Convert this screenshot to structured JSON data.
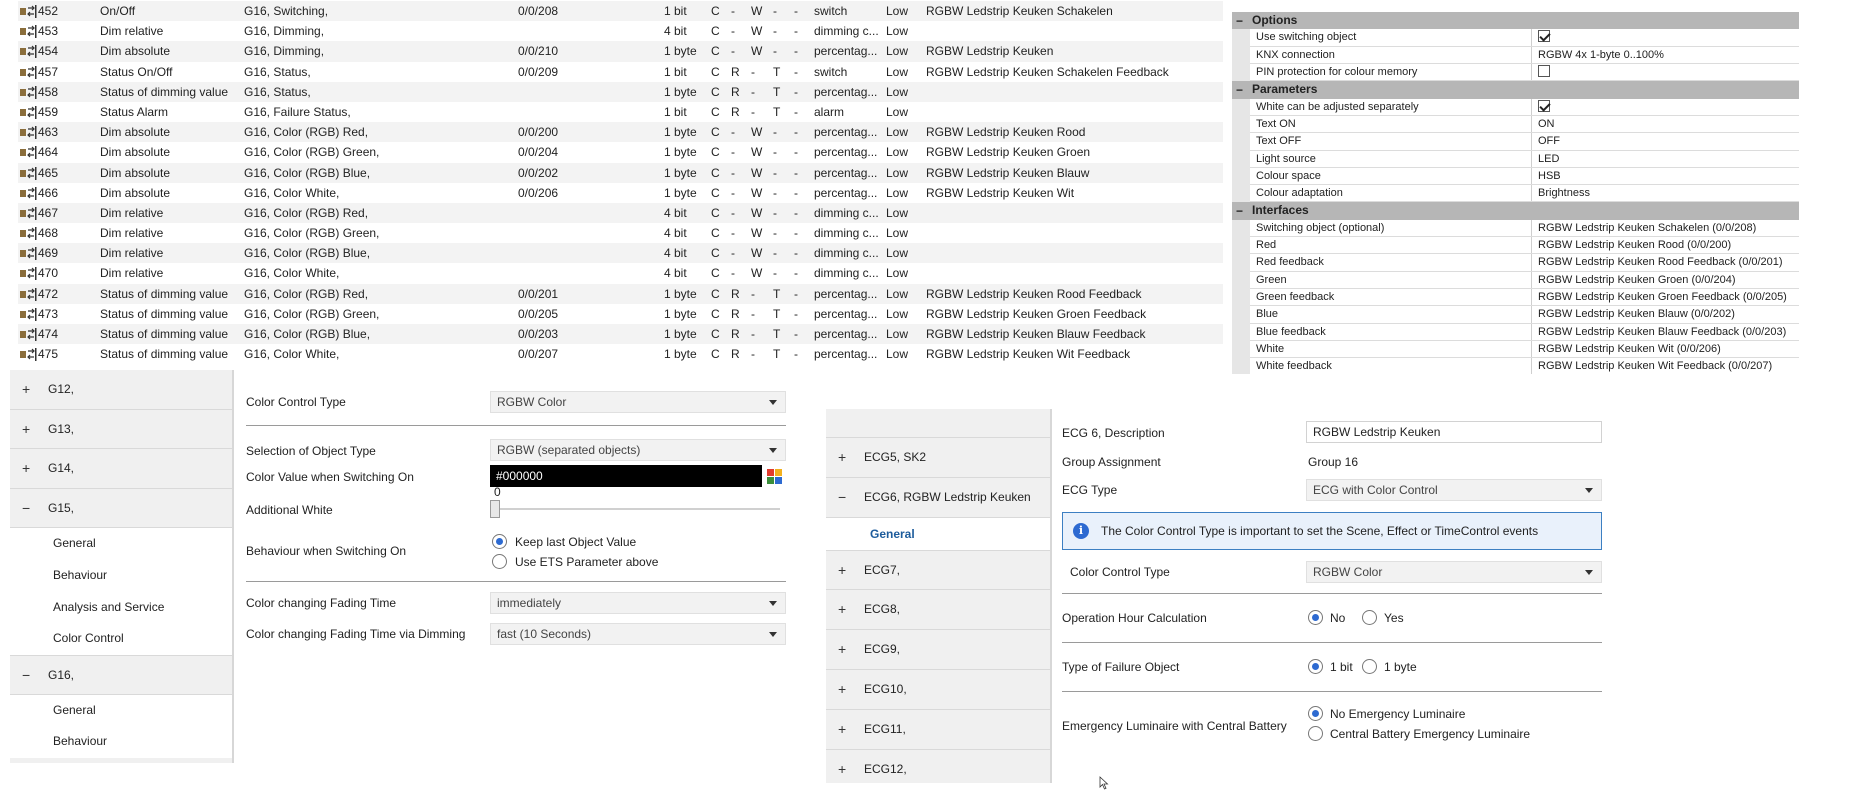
{
  "objects": [
    {
      "num": "452",
      "name": "On/Off",
      "func": "G16, Switching,",
      "addr": "0/0/208",
      "len": "1 bit",
      "c": "C",
      "r": "-",
      "w": "W",
      "t": "-",
      "u": "-",
      "dpt": "switch",
      "prio": "Low",
      "desc": "RGBW Ledstrip Keuken Schakelen"
    },
    {
      "num": "453",
      "name": "Dim relative",
      "func": "G16, Dimming,",
      "addr": "",
      "len": "4 bit",
      "c": "C",
      "r": "-",
      "w": "W",
      "t": "-",
      "u": "-",
      "dpt": "dimming c...",
      "prio": "Low",
      "desc": ""
    },
    {
      "num": "454",
      "name": "Dim absolute",
      "func": "G16, Dimming,",
      "addr": "0/0/210",
      "len": "1 byte",
      "c": "C",
      "r": "-",
      "w": "W",
      "t": "-",
      "u": "-",
      "dpt": "percentag...",
      "prio": "Low",
      "desc": "RGBW Ledstrip Keuken"
    },
    {
      "num": "457",
      "name": "Status On/Off",
      "func": "G16, Status,",
      "addr": "0/0/209",
      "len": "1 bit",
      "c": "C",
      "r": "R",
      "w": "-",
      "t": "T",
      "u": "-",
      "dpt": "switch",
      "prio": "Low",
      "desc": "RGBW Ledstrip Keuken Schakelen Feedback"
    },
    {
      "num": "458",
      "name": "Status of dimming value",
      "func": "G16, Status,",
      "addr": "",
      "len": "1 byte",
      "c": "C",
      "r": "R",
      "w": "-",
      "t": "T",
      "u": "-",
      "dpt": "percentag...",
      "prio": "Low",
      "desc": ""
    },
    {
      "num": "459",
      "name": "Status Alarm",
      "func": "G16, Failure Status,",
      "addr": "",
      "len": "1 bit",
      "c": "C",
      "r": "R",
      "w": "-",
      "t": "T",
      "u": "-",
      "dpt": "alarm",
      "prio": "Low",
      "desc": ""
    },
    {
      "num": "463",
      "name": "Dim absolute",
      "func": "G16, Color (RGB) Red,",
      "addr": "0/0/200",
      "len": "1 byte",
      "c": "C",
      "r": "-",
      "w": "W",
      "t": "-",
      "u": "-",
      "dpt": "percentag...",
      "prio": "Low",
      "desc": "RGBW Ledstrip Keuken Rood"
    },
    {
      "num": "464",
      "name": "Dim absolute",
      "func": "G16, Color (RGB) Green,",
      "addr": "0/0/204",
      "len": "1 byte",
      "c": "C",
      "r": "-",
      "w": "W",
      "t": "-",
      "u": "-",
      "dpt": "percentag...",
      "prio": "Low",
      "desc": "RGBW Ledstrip Keuken Groen"
    },
    {
      "num": "465",
      "name": "Dim absolute",
      "func": "G16, Color (RGB) Blue,",
      "addr": "0/0/202",
      "len": "1 byte",
      "c": "C",
      "r": "-",
      "w": "W",
      "t": "-",
      "u": "-",
      "dpt": "percentag...",
      "prio": "Low",
      "desc": "RGBW Ledstrip Keuken Blauw"
    },
    {
      "num": "466",
      "name": "Dim absolute",
      "func": "G16, Color White,",
      "addr": "0/0/206",
      "len": "1 byte",
      "c": "C",
      "r": "-",
      "w": "W",
      "t": "-",
      "u": "-",
      "dpt": "percentag...",
      "prio": "Low",
      "desc": "RGBW Ledstrip Keuken Wit"
    },
    {
      "num": "467",
      "name": "Dim relative",
      "func": "G16, Color (RGB) Red,",
      "addr": "",
      "len": "4 bit",
      "c": "C",
      "r": "-",
      "w": "W",
      "t": "-",
      "u": "-",
      "dpt": "dimming c...",
      "prio": "Low",
      "desc": ""
    },
    {
      "num": "468",
      "name": "Dim relative",
      "func": "G16, Color (RGB) Green,",
      "addr": "",
      "len": "4 bit",
      "c": "C",
      "r": "-",
      "w": "W",
      "t": "-",
      "u": "-",
      "dpt": "dimming c...",
      "prio": "Low",
      "desc": ""
    },
    {
      "num": "469",
      "name": "Dim relative",
      "func": "G16, Color (RGB) Blue,",
      "addr": "",
      "len": "4 bit",
      "c": "C",
      "r": "-",
      "w": "W",
      "t": "-",
      "u": "-",
      "dpt": "dimming c...",
      "prio": "Low",
      "desc": ""
    },
    {
      "num": "470",
      "name": "Dim relative",
      "func": "G16, Color White,",
      "addr": "",
      "len": "4 bit",
      "c": "C",
      "r": "-",
      "w": "W",
      "t": "-",
      "u": "-",
      "dpt": "dimming c...",
      "prio": "Low",
      "desc": ""
    },
    {
      "num": "472",
      "name": "Status of dimming value",
      "func": "G16, Color (RGB) Red,",
      "addr": "0/0/201",
      "len": "1 byte",
      "c": "C",
      "r": "R",
      "w": "-",
      "t": "T",
      "u": "-",
      "dpt": "percentag...",
      "prio": "Low",
      "desc": "RGBW Ledstrip Keuken Rood Feedback"
    },
    {
      "num": "473",
      "name": "Status of dimming value",
      "func": "G16, Color (RGB) Green,",
      "addr": "0/0/205",
      "len": "1 byte",
      "c": "C",
      "r": "R",
      "w": "-",
      "t": "T",
      "u": "-",
      "dpt": "percentag...",
      "prio": "Low",
      "desc": "RGBW Ledstrip Keuken Groen Feedback"
    },
    {
      "num": "474",
      "name": "Status of dimming value",
      "func": "G16, Color (RGB) Blue,",
      "addr": "0/0/203",
      "len": "1 byte",
      "c": "C",
      "r": "R",
      "w": "-",
      "t": "T",
      "u": "-",
      "dpt": "percentag...",
      "prio": "Low",
      "desc": "RGBW Ledstrip Keuken Blauw Feedback"
    },
    {
      "num": "475",
      "name": "Status of dimming value",
      "func": "G16, Color White,",
      "addr": "0/0/207",
      "len": "1 byte",
      "c": "C",
      "r": "R",
      "w": "-",
      "t": "T",
      "u": "-",
      "dpt": "percentag...",
      "prio": "Low",
      "desc": "RGBW Ledstrip Keuken Wit Feedback"
    }
  ],
  "props": {
    "categories": [
      {
        "name": "Options",
        "toggle": "−",
        "rows": [
          {
            "key": "Use switching object",
            "check": true
          },
          {
            "key": "KNX connection",
            "value": "RGBW 4x 1-byte 0..100%"
          },
          {
            "key": "PIN protection for colour memory",
            "check": false
          }
        ]
      },
      {
        "name": "Parameters",
        "toggle": "−",
        "rows": [
          {
            "key": "White can be adjusted separately",
            "check": true
          },
          {
            "key": "Text ON",
            "value": "ON"
          },
          {
            "key": "Text OFF",
            "value": "OFF"
          },
          {
            "key": "Light source",
            "value": "LED"
          },
          {
            "key": "Colour space",
            "value": "HSB"
          },
          {
            "key": "Colour adaptation",
            "value": "Brightness"
          }
        ]
      },
      {
        "name": "Interfaces",
        "toggle": "−",
        "rows": [
          {
            "key": "Switching object (optional)",
            "value": "RGBW Ledstrip Keuken Schakelen (0/0/208)"
          },
          {
            "key": "Red",
            "value": "RGBW Ledstrip Keuken Rood (0/0/200)"
          },
          {
            "key": "Red feedback",
            "value": "RGBW Ledstrip Keuken Rood Feedback (0/0/201)"
          },
          {
            "key": "Green",
            "value": "RGBW Ledstrip Keuken Groen (0/0/204)"
          },
          {
            "key": "Green feedback",
            "value": "RGBW Ledstrip Keuken Groen Feedback (0/0/205)"
          },
          {
            "key": "Blue",
            "value": "RGBW Ledstrip Keuken Blauw (0/0/202)"
          },
          {
            "key": "Blue feedback",
            "value": "RGBW Ledstrip Keuken Blauw Feedback (0/0/203)"
          },
          {
            "key": "White",
            "value": "RGBW Ledstrip Keuken Wit (0/0/206)"
          },
          {
            "key": "White feedback",
            "value": "RGBW Ledstrip Keuken Wit Feedback (0/0/207)"
          }
        ]
      }
    ]
  },
  "tree1": {
    "g12": {
      "sign": "+",
      "label": "G12,"
    },
    "g13": {
      "sign": "+",
      "label": "G13,"
    },
    "g14": {
      "sign": "+",
      "label": "G14,"
    },
    "g15": {
      "sign": "−",
      "label": "G15,"
    },
    "g15_children": [
      "General",
      "Behaviour",
      "Analysis and Service",
      "Color Control"
    ],
    "g16": {
      "sign": "−",
      "label": "G16,"
    },
    "g16_children": [
      "General",
      "Behaviour"
    ]
  },
  "panel1": {
    "color_control_type": {
      "label": "Color Control Type",
      "value": "RGBW Color"
    },
    "selection_object_type": {
      "label": "Selection of Object Type",
      "value": "RGBW (separated objects)"
    },
    "color_value_on": {
      "label": "Color Value when Switching On",
      "value": "#000000"
    },
    "additional_white": {
      "label": "Additional White",
      "value": "0",
      "level": 0
    },
    "behaviour_on": {
      "label": "Behaviour when Switching On",
      "options": [
        "Keep last Object Value",
        "Use ETS Parameter above"
      ],
      "selected": 0
    },
    "fading_time": {
      "label": "Color changing Fading Time",
      "value": "immediately"
    },
    "fading_time_dimming": {
      "label": "Color changing Fading Time via Dimming",
      "value": "fast (10 Seconds)"
    }
  },
  "tree2": {
    "ecg5": {
      "sign": "+",
      "label": "ECG5, SK2"
    },
    "ecg6": {
      "sign": "−",
      "label": "ECG6, RGBW Ledstrip Keuken"
    },
    "ecg6_selected": "General",
    "others": [
      {
        "sign": "+",
        "label": "ECG7,"
      },
      {
        "sign": "+",
        "label": "ECG8,"
      },
      {
        "sign": "+",
        "label": "ECG9,"
      },
      {
        "sign": "+",
        "label": "ECG10,"
      },
      {
        "sign": "+",
        "label": "ECG11,"
      },
      {
        "sign": "+",
        "label": "ECG12,"
      }
    ]
  },
  "panel2": {
    "description": {
      "label": "ECG 6, Description",
      "value": "RGBW Ledstrip Keuken"
    },
    "group_assignment": {
      "label": "Group Assignment",
      "value": "Group 16"
    },
    "ecg_type": {
      "label": "ECG Type",
      "value": "ECG with Color Control"
    },
    "info": "The Color Control Type is important to set the Scene, Effect or TimeControl events",
    "color_control_type": {
      "label": "Color Control Type",
      "value": "RGBW Color"
    },
    "operation_hour": {
      "label": "Operation Hour Calculation",
      "options": [
        "No",
        "Yes"
      ],
      "selected": 0
    },
    "failure_object": {
      "label": "Type of Failure Object",
      "options": [
        "1 bit",
        "1 byte"
      ],
      "selected": 0
    },
    "emergency": {
      "label": "Emergency Luminaire with Central Battery",
      "options": [
        "No Emergency Luminaire",
        "Central Battery Emergency Luminaire"
      ],
      "selected": 0
    }
  },
  "colors": {
    "accent": "#2d6ad1",
    "info_border": "#3c7fc2",
    "category": "#b6b6b6"
  },
  "icons": {
    "object": "group-object-icon",
    "info": "info-icon",
    "palette": "color-palette-icon",
    "cursor": "mouse-cursor-icon"
  }
}
